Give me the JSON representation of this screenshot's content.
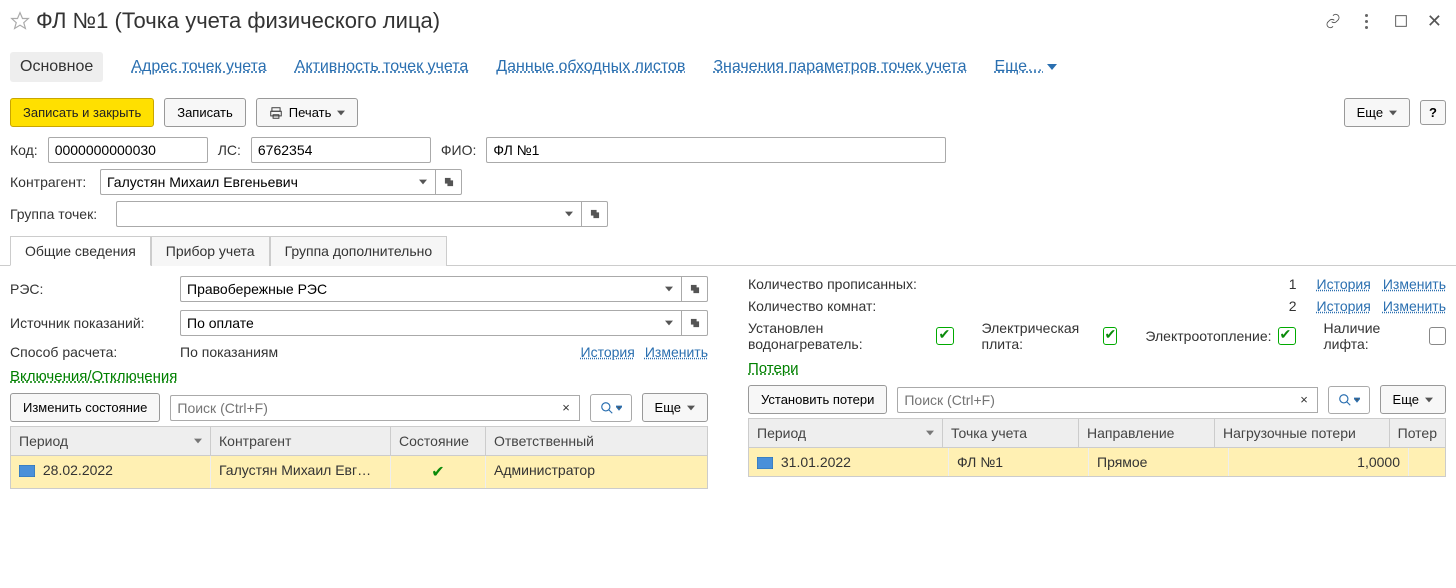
{
  "title": "ФЛ №1 (Точка учета физического лица)",
  "nav": {
    "main": "Основное",
    "addr": "Адрес точек учета",
    "activity": "Активность точек учета",
    "bypass": "Данные обходных листов",
    "params": "Значения параметров точек учета",
    "more": "Еще…"
  },
  "cmd": {
    "write_close": "Записать и закрыть",
    "write": "Записать",
    "print": "Печать",
    "more": "Еще",
    "help": "?"
  },
  "fields": {
    "code_lbl": "Код:",
    "code": "0000000000030",
    "ls_lbl": "ЛС:",
    "ls": "6762354",
    "fio_lbl": "ФИО:",
    "fio": "ФЛ №1",
    "contr_lbl": "Контрагент:",
    "contr": "Галустян Михаил Евгеньевич",
    "group_lbl": "Группа точек:",
    "group": ""
  },
  "tabs2": {
    "general": "Общие сведения",
    "device": "Прибор учета",
    "groupadd": "Группа дополнительно"
  },
  "left": {
    "res_lbl": "РЭС:",
    "res": "Правобережные РЭС",
    "src_lbl": "Источник показаний:",
    "src": "По оплате",
    "calc_lbl": "Способ расчета:",
    "calc": "По показаниям",
    "history": "История",
    "change": "Изменить",
    "sect_onoff": "Включения/Отключения",
    "change_state": "Изменить состояние",
    "search_ph": "Поиск (Ctrl+F)",
    "more": "Еще",
    "grid_period": "Период",
    "grid_contr": "Контрагент",
    "grid_state": "Состояние",
    "grid_resp": "Ответственный",
    "row_date": "28.02.2022",
    "row_contr": "Галустян Михаил Евг…",
    "row_resp": "Администратор"
  },
  "right": {
    "reg_lbl": "Количество прописанных:",
    "reg_val": "1",
    "rooms_lbl": "Количество комнат:",
    "rooms_val": "2",
    "history": "История",
    "change": "Изменить",
    "heater_lbl": "Установлен водонагреватель:",
    "stove_lbl": "Электрическая плита:",
    "eheat_lbl": "Электроотопление:",
    "lift_lbl": "Наличие лифта:",
    "sect_losses": "Потери",
    "set_losses": "Установить потери",
    "search_ph": "Поиск (Ctrl+F)",
    "more": "Еще",
    "grid_period": "Период",
    "grid_point": "Точка учета",
    "grid_dir": "Направление",
    "grid_load": "Нагрузочные потери",
    "grid_pot": "Потер",
    "row_date": "31.01.2022",
    "row_point": "ФЛ №1",
    "row_dir": "Прямое",
    "row_load": "1,0000"
  }
}
